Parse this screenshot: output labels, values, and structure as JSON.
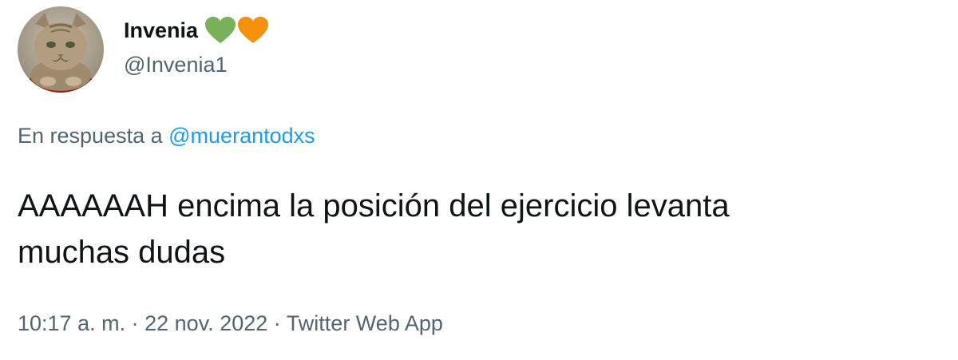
{
  "user": {
    "display_name": "Invenia",
    "handle": "@Invenia1",
    "avatar": "cat-portrait-avatar",
    "badges": [
      {
        "icon": "green-heart-icon",
        "color": "#78b159"
      },
      {
        "icon": "orange-heart-icon",
        "color": "#f4900c"
      }
    ]
  },
  "reply": {
    "prefix": "En respuesta a",
    "mention": "@muerantodxs"
  },
  "tweet": {
    "text_line1": "AAAAAAH encima la posición del ejercicio levanta",
    "text_line2": "muchas dudas"
  },
  "meta": {
    "time": "10:17 a. m.",
    "separator": "·",
    "date": "22 nov. 2022",
    "source": "Twitter Web App"
  },
  "colors": {
    "text_primary": "#0f1419",
    "text_secondary": "#536471",
    "link": "#1d9bf0"
  }
}
